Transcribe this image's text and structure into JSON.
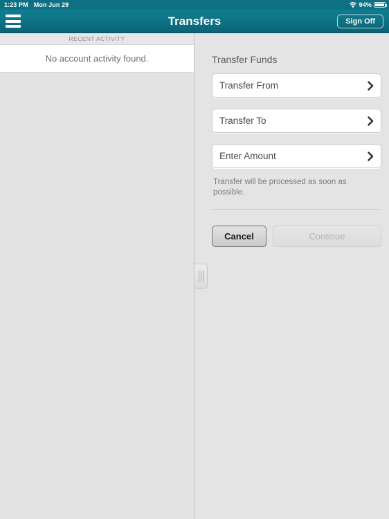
{
  "statusbar": {
    "time": "1:23 PM",
    "date": "Mon Jun 29",
    "battery_percent": "94%",
    "wifi_icon": "wifi-icon",
    "battery_icon": "battery-icon"
  },
  "navbar": {
    "title": "Transfers",
    "menu_icon": "hamburger-menu-icon",
    "sign_off_label": "Sign Off"
  },
  "left_pane": {
    "section_header": "RECENT ACTIVITY",
    "empty_message": "No account activity found."
  },
  "splitter": {
    "grip_icon": "grip-handle-icon"
  },
  "form": {
    "title": "Transfer Funds",
    "fields": [
      {
        "label": "Transfer From",
        "chevron_icon": "chevron-right-icon"
      },
      {
        "label": "Transfer To",
        "chevron_icon": "chevron-right-icon"
      },
      {
        "label": "Enter Amount",
        "chevron_icon": "chevron-right-icon"
      }
    ],
    "note": "Transfer will be processed as soon as possible.",
    "cancel_label": "Cancel",
    "continue_label": "Continue"
  },
  "colors": {
    "accent_teal": "#0d7587",
    "status_teal": "#0e7183",
    "pane_gray": "#e3e3e3",
    "field_white": "#ffffff",
    "disabled_text": "#b3b3b3"
  }
}
